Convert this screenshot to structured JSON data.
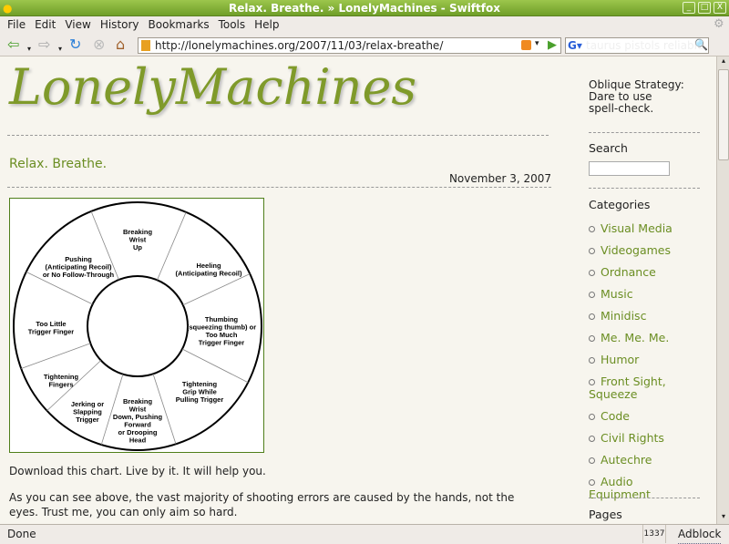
{
  "window": {
    "title": "Relax. Breathe. » LonelyMachines - Swiftfox"
  },
  "menu": [
    "File",
    "Edit",
    "View",
    "History",
    "Bookmarks",
    "Tools",
    "Help"
  ],
  "nav": {
    "url": "http://lonelymachines.org/2007/11/03/relax-breathe/",
    "search_value": "taurus pistols reliable"
  },
  "site": {
    "logo": "LonelyMachines"
  },
  "post": {
    "title": "Relax. Breathe.",
    "date": "November 3, 2007",
    "p1": "Download this chart. Live by it. It will help you.",
    "p2": "As you can see above, the vast majority of shooting errors are caused by the hands, not the eyes. Trust me, you can only aim so hard."
  },
  "wheel": [
    [
      "Breaking",
      "Wrist",
      "Up"
    ],
    [
      "Heeling",
      "(Anticipating Recoil)"
    ],
    [
      "Thumbing",
      "(squeezing thumb) or",
      "Too Much",
      "Trigger Finger"
    ],
    [
      "Tightening",
      "Grip While",
      "Pulling Trigger"
    ],
    [
      "Breaking",
      "Wrist",
      "Down, Pushing",
      "Forward",
      "or Drooping",
      "Head"
    ],
    [
      "Jerking or",
      "Slapping",
      "Trigger"
    ],
    [
      "Tightening",
      "Fingers"
    ],
    [
      "Too Little",
      "Trigger Finger"
    ],
    [
      "Pushing",
      "(Anticipating Recoil)",
      "or No Follow-Through"
    ]
  ],
  "sidebar": {
    "oblique": [
      "Oblique Strategy:",
      "Dare to use",
      "spell-check."
    ],
    "search_label": "Search",
    "categories_label": "Categories",
    "categories": [
      "Visual Media",
      "Videogames",
      "Ordnance",
      "Music",
      "Minidisc",
      "Me. Me. Me.",
      "Humor",
      "Front Sight, Squeeze",
      "Code",
      "Civil Rights",
      "Autechre",
      "Audio Equipment"
    ],
    "pages_label": "Pages"
  },
  "status": {
    "text": "Done",
    "counter": "1337",
    "adblock": "Adblock"
  },
  "colors": {
    "accent": "#6b8e23",
    "titlebar": "#7fae30"
  }
}
